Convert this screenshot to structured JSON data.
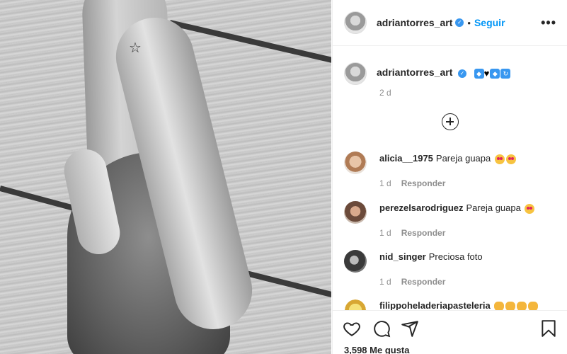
{
  "post": {
    "username": "adriantorres_art",
    "follow_label": "Seguir",
    "separator": "•",
    "more_label": "•••"
  },
  "caption": {
    "username": "adriantorres_art",
    "emojis": [
      "blue-gem-emoji",
      "black-heart-emoji",
      "blue-gem-emoji",
      "repeat-symbol-emoji"
    ],
    "time": "2 d"
  },
  "comments": [
    {
      "user": "alicia__1975",
      "text": "Pareja guapa",
      "emojis": [
        "heart-eyes-emoji",
        "heart-eyes-emoji"
      ],
      "time": "1 d",
      "reply_label": "Responder"
    },
    {
      "user": "perezelsarodriguez",
      "text": "Pareja guapa",
      "emojis": [
        "heart-eyes-emoji"
      ],
      "time": "1 d",
      "reply_label": "Responder"
    },
    {
      "user": "nid_singer",
      "text": "Preciosa foto",
      "emojis": [],
      "time": "1 d",
      "reply_label": "Responder"
    },
    {
      "user": "filippoheladeriapasteleria",
      "text": "",
      "emojis": [
        "clapping-hands-emoji",
        "clapping-hands-emoji",
        "clapping-hands-emoji",
        "clapping-hands-emoji"
      ],
      "time": "",
      "reply_label": ""
    }
  ],
  "footer": {
    "likes": "3,598 Me gusta"
  },
  "icons": {
    "like": "heart-outline-icon",
    "comment": "comment-bubble-icon",
    "share": "paper-plane-icon",
    "save": "bookmark-icon",
    "load_more": "plus-circle-icon"
  },
  "colors": {
    "accent": "#0095f6",
    "verified": "#3897f0",
    "muted": "#8e8e8e",
    "text": "#262626"
  }
}
